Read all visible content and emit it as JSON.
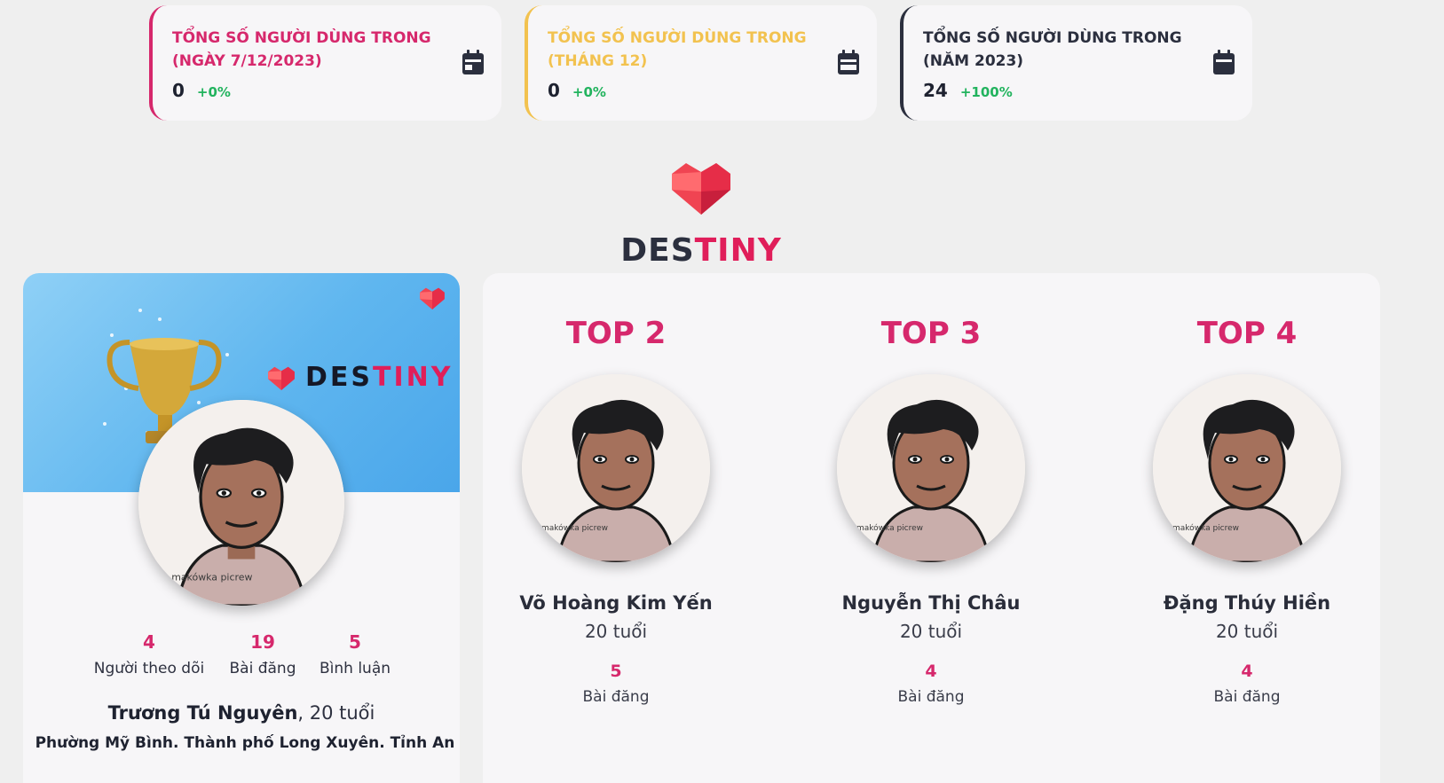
{
  "stats": [
    {
      "title": "TỔNG SỐ NGƯỜI DÙNG TRONG (NGÀY 7/12/2023)",
      "value": "0",
      "change": "+0%",
      "color": "#d6286c"
    },
    {
      "title": "TỔNG SỐ NGƯỜI DÙNG TRONG (THÁNG 12)",
      "value": "0",
      "change": "+0%",
      "color": "#f2c24f"
    },
    {
      "title": "TỔNG SỐ NGƯỜI DÙNG TRONG (NĂM 2023)",
      "value": "24",
      "change": "+100%",
      "color": "#2b2f3e"
    }
  ],
  "brand": {
    "part1": "DES",
    "part2": "TINY"
  },
  "top1": {
    "banner_brand_part1": "DES",
    "banner_brand_part2": "TINY",
    "followers": "4",
    "followers_label": "Người theo dõi",
    "posts": "19",
    "posts_label": "Bài đăng",
    "comments": "5",
    "comments_label": "Bình luận",
    "name": "Trương Tú Nguyên",
    "age_text": ", 20 tuổi",
    "address": "Phường Mỹ Bình. Thành phố Long Xuyên. Tỉnh An"
  },
  "ranking": [
    {
      "label": "TOP 2",
      "name": "Võ Hoàng Kim Yến",
      "age": "20 tuổi",
      "posts": "5",
      "posts_label": "Bài đăng"
    },
    {
      "label": "TOP 3",
      "name": "Nguyễn Thị Châu",
      "age": "20 tuổi",
      "posts": "4",
      "posts_label": "Bài đăng"
    },
    {
      "label": "TOP 4",
      "name": "Đặng Thúy Hiền",
      "age": "20 tuổi",
      "posts": "4",
      "posts_label": "Bài đăng"
    }
  ],
  "avatar_watermark": "makówka picrew",
  "colors": {
    "accent": "#d6286c",
    "positive": "#22b35e",
    "brand_red": "#e01e5a"
  }
}
